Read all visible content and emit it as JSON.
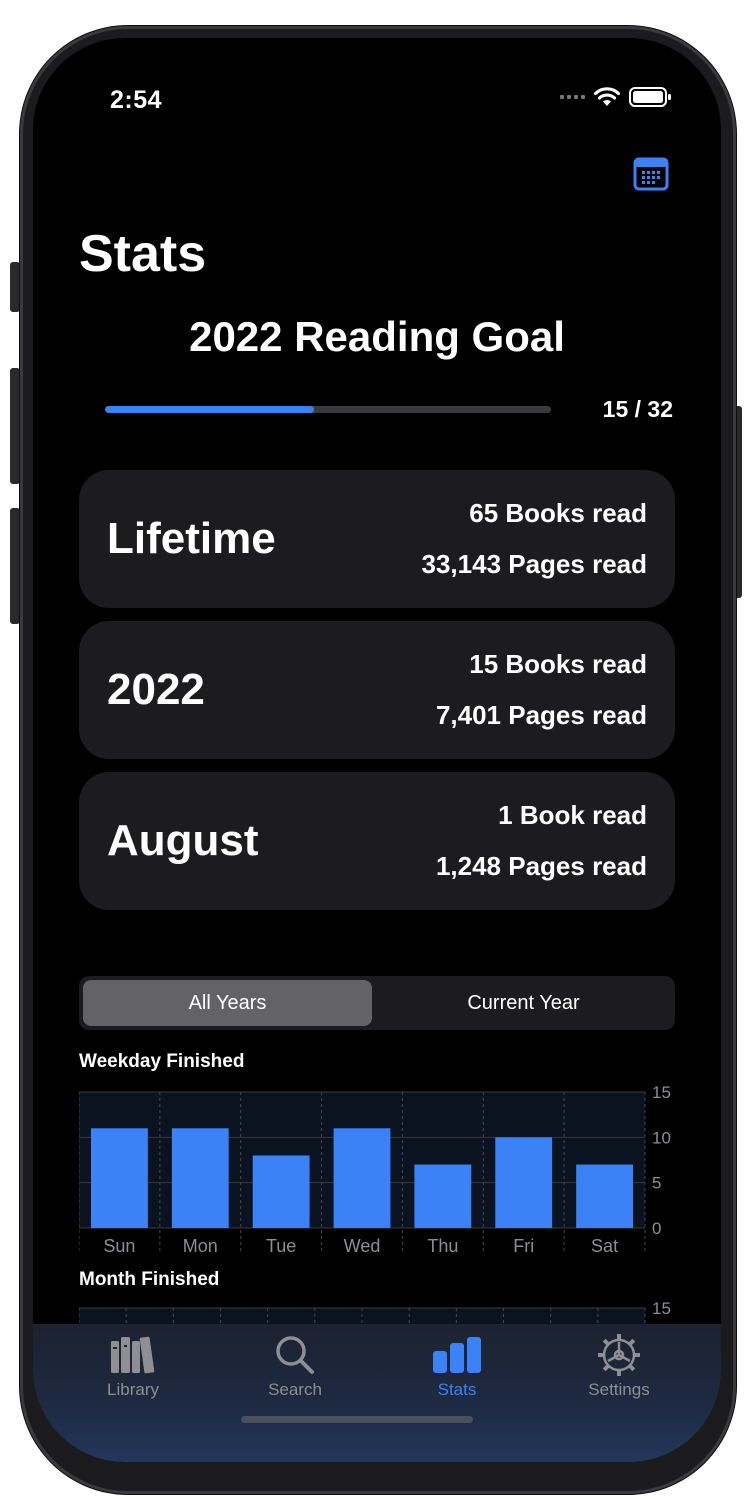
{
  "status_bar": {
    "time": "2:54"
  },
  "header": {
    "title": "Stats"
  },
  "goal": {
    "title": "2022 Reading Goal",
    "label": "15 / 32",
    "current": 15,
    "target": 32
  },
  "cards": [
    {
      "label": "Lifetime",
      "line1": "65 Books read",
      "line2": "33,143 Pages read"
    },
    {
      "label": "2022",
      "line1": "15 Books read",
      "line2": "7,401 Pages read"
    },
    {
      "label": "August",
      "line1": "1 Book read",
      "line2": "1,248 Pages read"
    }
  ],
  "segmented": {
    "options": [
      "All Years",
      "Current Year"
    ],
    "selected": "All Years"
  },
  "chart_titles": {
    "weekday": "Weekday Finished",
    "month": "Month Finished"
  },
  "chart_data": [
    {
      "type": "bar",
      "title": "Weekday Finished",
      "categories": [
        "Sun",
        "Mon",
        "Tue",
        "Wed",
        "Thu",
        "Fri",
        "Sat"
      ],
      "values": [
        11,
        11,
        8,
        11,
        7,
        10,
        7
      ],
      "ylim": [
        0,
        15
      ],
      "yticks": [
        0,
        5,
        10,
        15
      ],
      "grid": true,
      "color": "#3b82f6"
    },
    {
      "type": "bar",
      "title": "Month Finished",
      "ylim": [
        0,
        15
      ],
      "yticks": [
        15
      ],
      "grid": true
    }
  ],
  "tabbar": {
    "items": [
      {
        "label": "Library",
        "icon": "books-icon"
      },
      {
        "label": "Search",
        "icon": "magnifier-icon"
      },
      {
        "label": "Stats",
        "icon": "bar-chart-icon"
      },
      {
        "label": "Settings",
        "icon": "gear-icon"
      }
    ],
    "active": "Stats"
  },
  "colors": {
    "accent": "#3b82f6",
    "card": "#1c1c1e",
    "background": "#000000"
  }
}
